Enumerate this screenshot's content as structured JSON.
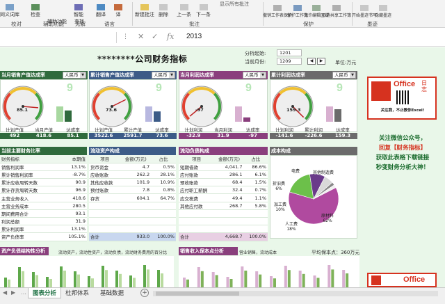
{
  "ribbon": {
    "buttons": [
      {
        "name": "thesaurus",
        "label": "同义词库"
      },
      {
        "name": "check-accessibility",
        "label": "检查"
      },
      {
        "name": "smart-lookup",
        "label": "智能"
      },
      {
        "name": "translate",
        "label": "翻译"
      },
      {
        "name": "new-comment",
        "label": "新建批注"
      },
      {
        "name": "delete-comment",
        "label": "删除"
      },
      {
        "name": "prev-comment",
        "label": "上一条"
      },
      {
        "name": "next-comment",
        "label": "下一条"
      },
      {
        "name": "protect-workbook",
        "label": "保护工作簿"
      },
      {
        "name": "allow-edit-ranges",
        "label": "允许编辑区域"
      },
      {
        "name": "unshare-workbook",
        "label": "取消共享工作簿"
      },
      {
        "name": "start-ink",
        "label": "开始墨迹书写"
      },
      {
        "name": "hide-ink",
        "label": "隐藏墨迹"
      }
    ],
    "sub_labels": {
      "check2": "辅助功能",
      "smart2": "查找",
      "trans2": "译"
    },
    "show_all_comments": "显示所有批注",
    "protect_sheet": "撤销工作表保护",
    "groups": [
      "校对",
      "辅助功能",
      "见解",
      "语言",
      "批注",
      "保护",
      "墨迹"
    ]
  },
  "formula_bar": {
    "value": "2013"
  },
  "dashboard": {
    "title": "********公司财务指标",
    "analysis_start_label": "分析起始:",
    "analysis_start_value": "1201",
    "current_month_label": "当前月份:",
    "current_month_value": "1209",
    "unit_label": "单位:万元",
    "currency": "人民币"
  },
  "gauges": [
    {
      "title": "当月销售产值达成率",
      "value": "85.1",
      "digit": "9",
      "labels": [
        "计划产值",
        "当月产值",
        "达成率"
      ],
      "values": [
        "492",
        "418.6",
        "85.1"
      ],
      "row_color": "#2f6a3c",
      "fill": 0.851
    },
    {
      "title": "累计销售产值达成率",
      "value": "73.6",
      "digit": "9",
      "labels": [
        "计划产值",
        "累计产值",
        "达成率"
      ],
      "values": [
        "3522.6",
        "2591.7",
        "73.6"
      ],
      "row_color": "#3c5b87",
      "fill": 0.736
    },
    {
      "title": "当月利润达成率",
      "value": "-97",
      "digit": "9",
      "labels": [
        "计划利润",
        "当月利润",
        "达成率"
      ],
      "values": [
        "-32.9",
        "31.9",
        "-97"
      ],
      "row_color": "#8a3f7d",
      "fill": 0.02
    },
    {
      "title": "累计利润达成率",
      "value": "159.3",
      "digit": "9",
      "labels": [
        "计划利润",
        "累计利润",
        "达成率"
      ],
      "values": [
        "-141.6",
        "-226.6",
        "159.3"
      ],
      "row_color": "#6b6b6b",
      "fill": 1.0
    }
  ],
  "ratios": {
    "title": "当前主要财务比率",
    "header": [
      "财务指标",
      "本期值"
    ],
    "rows": [
      [
        "销售利润率",
        "13.1%"
      ],
      [
        "累计销售利润率",
        "-8.7%"
      ],
      [
        "累计应收周转天数",
        "90.9"
      ],
      [
        "累计存货周转天数",
        "96.9"
      ],
      [
        "主营业务收入",
        "418.6"
      ],
      [
        "主营业务成本",
        "280.5"
      ],
      [
        "期间费用合计",
        "93.1"
      ],
      [
        "利润总额",
        "31.9"
      ],
      [
        "累计利润率",
        "13.1%"
      ],
      [
        "资产负债率",
        "105.1%"
      ]
    ]
  },
  "current_assets": {
    "title": "流动资产构成",
    "header": [
      "项目",
      "金额(万元)",
      "占比"
    ],
    "rows": [
      [
        "货币资金",
        "4.7",
        "0.5%"
      ],
      [
        "应收账款",
        "262.2",
        "28.1%"
      ],
      [
        "其他应收款",
        "101.9",
        "10.9%"
      ],
      [
        "预付账款",
        "7.8",
        "0.8%"
      ],
      [
        "存货",
        "604.1",
        "64.7%"
      ]
    ],
    "total": [
      "合计",
      "933.0",
      "100.0%"
    ]
  },
  "current_liabilities": {
    "title": "流动负债构成",
    "header": [
      "项目",
      "金额(万元)",
      "占比"
    ],
    "rows": [
      [
        "短期借款",
        "4,041.7",
        "86.6%"
      ],
      [
        "应付账款",
        "286.1",
        "6.1%"
      ],
      [
        "预收账款",
        "68.4",
        "1.5%"
      ],
      [
        "应付职工薪酬",
        "32.4",
        "0.7%"
      ],
      [
        "应交税费",
        "49.4",
        "1.1%"
      ],
      [
        "其他应付款",
        "268.7",
        "5.8%"
      ]
    ],
    "total": [
      "合计",
      "4,668.7",
      "100.0%"
    ]
  },
  "cost": {
    "title": "成本构成",
    "slices": [
      {
        "label": "原材料",
        "pct": "62%",
        "value": 62,
        "color": "#b04a9f"
      },
      {
        "label": "人工费",
        "pct": "18%",
        "value": 18,
        "color": "#6cc04a"
      },
      {
        "label": "加工费",
        "pct": "10%",
        "value": 10,
        "color": "#6a3a8a"
      },
      {
        "label": "折旧费",
        "pct": "6%",
        "value": 6,
        "color": "#d9d9d9"
      },
      {
        "label": "电费",
        "pct": "",
        "value": 2,
        "color": "#888888"
      },
      {
        "label": "其他制造费",
        "pct": "",
        "value": 2,
        "color": "#f0f0f0"
      }
    ]
  },
  "promo": {
    "brand": "Office",
    "brand_cn": "日志",
    "line1": "关注微信公众号，",
    "line2": "回复【财务指标】",
    "line3": "获取此表格下载链接",
    "line4": "秒变财务分析大神！",
    "qr_caption": "关注我，不止教你Excel!"
  },
  "bottom_left": {
    "title": "资产负债结构性分析",
    "subtitle": "流动资产，流动性资产，流动负债，流动财务费用的百分比"
  },
  "bottom_mid": {
    "title": "销售收入保本点分析",
    "subtitle": "营业销售，流动成本",
    "right_label": "平均保本点：360万元"
  },
  "sheet_tabs": [
    "图表分析",
    "杜邦体系",
    "基础数据"
  ],
  "colors": {
    "green": "#2f6a3c",
    "blue": "#3c5b87",
    "purple": "#8a3f7d",
    "excel": "#217346",
    "bg": "#e9f7e9"
  }
}
